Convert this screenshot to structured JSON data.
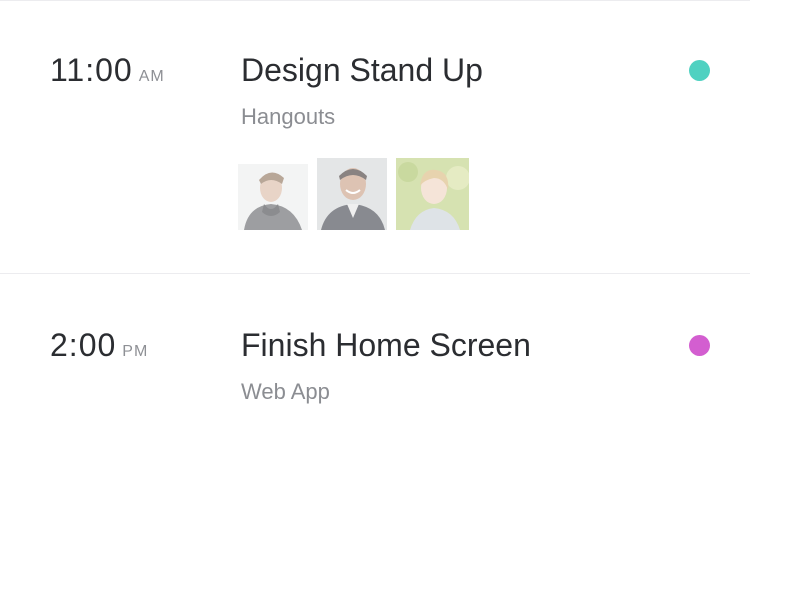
{
  "events": [
    {
      "time": "11:00",
      "period": "AM",
      "title": "Design Stand Up",
      "subtitle": "Hangouts",
      "status_color": "#4fd1c1",
      "attendees": [
        {
          "icon": "person-photo"
        },
        {
          "icon": "person-photo"
        },
        {
          "icon": "person-photo"
        }
      ]
    },
    {
      "time": "2:00",
      "period": "PM",
      "title": "Finish Home Screen",
      "subtitle": "Web App",
      "status_color": "#d35ed0"
    }
  ]
}
